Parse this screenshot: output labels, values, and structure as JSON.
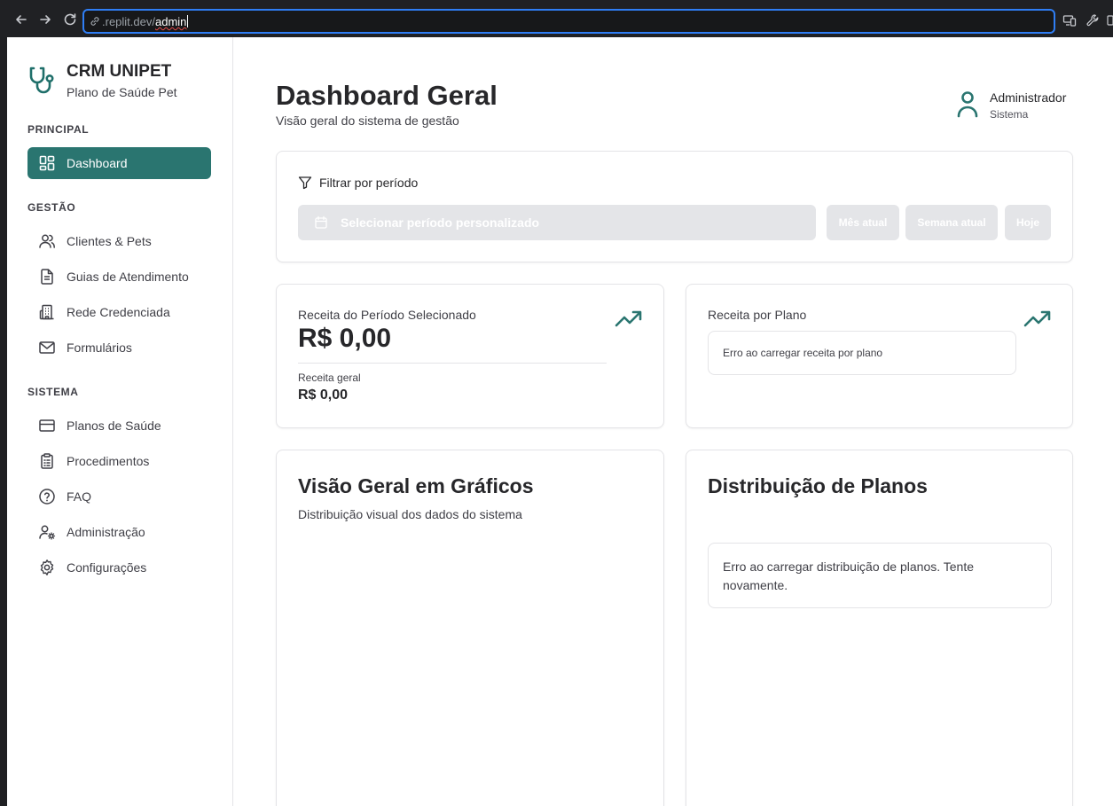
{
  "browser": {
    "url_domain": ".replit.dev/",
    "url_path": "admin"
  },
  "sidebar": {
    "brand_title": "CRM UNIPET",
    "brand_subtitle": "Plano de Saúde Pet",
    "sections": {
      "principal": "PRINCIPAL",
      "gestao": "GESTÃO",
      "sistema": "SISTEMA"
    },
    "items": {
      "dashboard": "Dashboard",
      "clientes": "Clientes & Pets",
      "guias": "Guias de Atendimento",
      "rede": "Rede Credenciada",
      "formularios": "Formulários",
      "planos": "Planos de Saúde",
      "procedimentos": "Procedimentos",
      "faq": "FAQ",
      "administracao": "Administração",
      "configuracoes": "Configurações"
    },
    "accent_color": "#2a7570"
  },
  "header": {
    "title": "Dashboard Geral",
    "subtitle": "Visão geral do sistema de gestão",
    "user_name": "Administrador",
    "user_role": "Sistema"
  },
  "filter": {
    "title": "Filtrar por período",
    "range_placeholder": "Selecionar período personalizado",
    "btn_month": "Mês atual",
    "btn_week": "Semana atual",
    "btn_today": "Hoje"
  },
  "revenue": {
    "label": "Receita do Período Selecionado",
    "value": "R$ 0,00",
    "general_label": "Receita geral",
    "general_value": "R$ 0,00"
  },
  "plan_revenue": {
    "label": "Receita por Plano",
    "error": "Erro ao carregar receita por plano"
  },
  "charts": {
    "title": "Visão Geral em Gráficos",
    "subtitle": "Distribuição visual dos dados do sistema"
  },
  "distribution": {
    "title": "Distribuição de Planos",
    "error": "Erro ao carregar distribuição de planos. Tente novamente."
  }
}
